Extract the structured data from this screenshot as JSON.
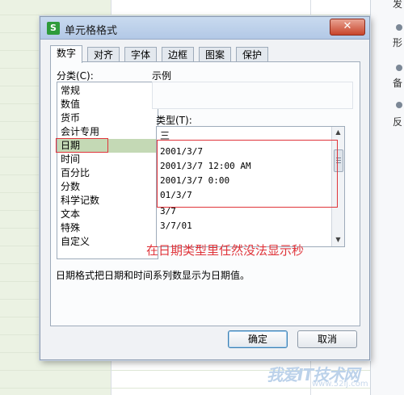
{
  "dialog": {
    "title": "单元格格式",
    "app_icon": "S",
    "close_symbol": "✕"
  },
  "tabs": [
    "数字",
    "对齐",
    "字体",
    "边框",
    "图案",
    "保护"
  ],
  "category": {
    "label": "分类(C):",
    "items": [
      "常规",
      "数值",
      "货币",
      "会计专用",
      "日期",
      "时间",
      "百分比",
      "分数",
      "科学记数",
      "文本",
      "特殊",
      "自定义"
    ],
    "selected": "日期"
  },
  "sample": {
    "label": "示例"
  },
  "type": {
    "label": "类型(T):",
    "items": [
      "三",
      "2001/3/7",
      "2001/3/7 12:00 AM",
      "2001/3/7 0:00",
      "01/3/7",
      "3/7",
      "3/7/01"
    ]
  },
  "annotation": "在日期类型里任然没法显示秒",
  "description": "日期格式把日期和时间系列数显示为日期值。",
  "buttons": {
    "ok": "确定",
    "cancel": "取消"
  },
  "right_panel": {
    "items": [
      "发",
      "形",
      "备",
      "反"
    ]
  },
  "watermark": {
    "text": "我爱IT技术网",
    "url": "www.52ij.com"
  },
  "colors": {
    "annotation_red": "#e0343a",
    "selection_green": "#c4d9b5",
    "title_bar": "#b2c8e6"
  }
}
